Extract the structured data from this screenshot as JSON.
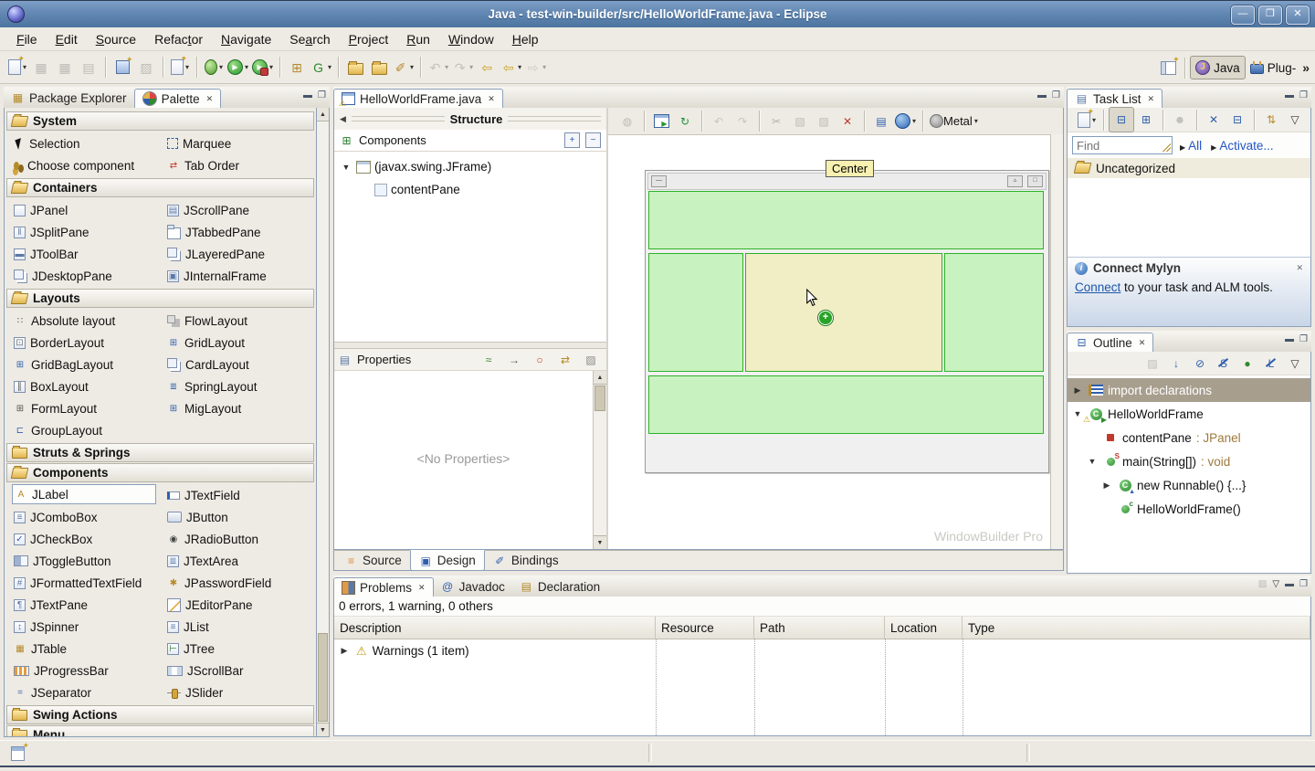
{
  "window": {
    "title": "Java - test-win-builder/src/HelloWorldFrame.java - Eclipse",
    "buttons": [
      {
        "name": "minimize-icon",
        "glyph": "—"
      },
      {
        "name": "maximize-icon",
        "glyph": "❐"
      },
      {
        "name": "close-icon",
        "glyph": "✕"
      }
    ]
  },
  "menu": {
    "items": [
      {
        "label": "File",
        "u": 0
      },
      {
        "label": "Edit",
        "u": 0
      },
      {
        "label": "Source",
        "u": 0
      },
      {
        "label": "Refactor",
        "u": 5
      },
      {
        "label": "Navigate",
        "u": 0
      },
      {
        "label": "Search",
        "u": 2
      },
      {
        "label": "Project",
        "u": 0
      },
      {
        "label": "Run",
        "u": 0
      },
      {
        "label": "Window",
        "u": 0
      },
      {
        "label": "Help",
        "u": 0
      }
    ]
  },
  "main_toolbar": {
    "groups": [
      [
        {
          "name": "new-wizard-icon",
          "k": "doc",
          "dd": true
        },
        {
          "name": "save-icon",
          "g": "▦",
          "c": "#777",
          "disabled": true
        },
        {
          "name": "save-all-icon",
          "g": "▦",
          "c": "#777",
          "disabled": true
        },
        {
          "name": "print-icon",
          "g": "▤",
          "c": "#777",
          "disabled": true
        }
      ],
      [
        {
          "name": "new-java-project-icon",
          "k": "doc2"
        },
        {
          "name": "type-hierarchy-icon",
          "g": "▨",
          "c": "#777",
          "disabled": true
        }
      ],
      [
        {
          "name": "open-wizard-icon",
          "k": "doc",
          "dd": true
        }
      ],
      [
        {
          "name": "debug-icon",
          "k": "bug",
          "dd": true
        },
        {
          "name": "run-icon",
          "k": "run",
          "dd": true
        },
        {
          "name": "run-last-icon",
          "k": "run2",
          "dd": true
        }
      ],
      [
        {
          "name": "new-java-class-icon",
          "g": "⊞",
          "c": "#b58a2a"
        },
        {
          "name": "gwt-compile-icon",
          "g": "G",
          "c": "#2e8b2e",
          "dd": true
        }
      ],
      [
        {
          "name": "open-type-icon",
          "k": "folder"
        },
        {
          "name": "open-resource-icon",
          "k": "folder"
        },
        {
          "name": "search-icon",
          "g": "✐",
          "c": "#b58a2a",
          "dd": true
        }
      ],
      [
        {
          "name": "last-edit-icon",
          "g": "↶",
          "c": "#888",
          "disabled": true,
          "dd": true
        },
        {
          "name": "next-annotation-icon",
          "g": "↷",
          "c": "#888",
          "disabled": true,
          "dd": true
        },
        {
          "name": "back-to-last-edit-icon",
          "g": "⇦",
          "c": "#c9a227"
        },
        {
          "name": "back-icon",
          "g": "⇦",
          "c": "#c9a227",
          "dd": true
        },
        {
          "name": "forward-icon",
          "g": "⇨",
          "c": "#c9a227",
          "disabled": true,
          "dd": true
        }
      ]
    ]
  },
  "perspective": {
    "open_icon": "open-perspective-icon",
    "buttons": [
      {
        "label": "Java",
        "icon": "java-perspective-icon",
        "active": true
      },
      {
        "label": "Plug-",
        "icon": "plugin-perspective-icon",
        "active": false
      }
    ],
    "more": "»"
  },
  "left_panel": {
    "tabs": [
      {
        "label": "Package Explorer",
        "icon": "package-explorer-icon",
        "active": false,
        "closable": false
      },
      {
        "label": "Palette",
        "icon": "palette-icon",
        "active": true,
        "closable": true
      }
    ],
    "palette": {
      "sections": [
        {
          "label": "System",
          "state": "open",
          "items": [
            {
              "label": "Selection",
              "icon": "selection-cursor-icon",
              "k": "cursor"
            },
            {
              "label": "Marquee",
              "icon": "marquee-icon",
              "k": "marquee"
            },
            {
              "label": "Choose component",
              "icon": "choose-component-icon",
              "k": "beans"
            },
            {
              "label": "Tab Order",
              "icon": "tab-order-icon",
              "g": "⇄",
              "c": "#c0392b"
            }
          ]
        },
        {
          "label": "Containers",
          "state": "open",
          "items": [
            {
              "label": "JPanel",
              "icon": "jpanel-icon",
              "box": true
            },
            {
              "label": "JScrollPane",
              "icon": "jscrollpane-icon",
              "box": true,
              "g": "▤",
              "c": "#5b79a6"
            },
            {
              "label": "JSplitPane",
              "icon": "jsplitpane-icon",
              "box": true,
              "g": "‖",
              "c": "#5b79a6"
            },
            {
              "label": "JTabbedPane",
              "icon": "jtabbedpane-icon",
              "k": "tabbed"
            },
            {
              "label": "JToolBar",
              "icon": "jtoolbar-icon",
              "box": true,
              "g": "▬",
              "c": "#5b79a6"
            },
            {
              "label": "JLayeredPane",
              "icon": "jlayeredpane-icon",
              "k": "layered"
            },
            {
              "label": "JDesktopPane",
              "icon": "jdesktoppane-icon",
              "k": "layered"
            },
            {
              "label": "JInternalFrame",
              "icon": "jinternalframe-icon",
              "box": true,
              "g": "▣",
              "c": "#5b79a6"
            }
          ]
        },
        {
          "label": "Layouts",
          "state": "open",
          "items": [
            {
              "label": "Absolute layout",
              "icon": "absolute-layout-icon",
              "g": "∷",
              "c": "#555"
            },
            {
              "label": "FlowLayout",
              "icon": "flowlayout-icon",
              "k": "flow"
            },
            {
              "label": "BorderLayout",
              "icon": "borderlayout-icon",
              "box": true,
              "g": "⊡",
              "c": "#777"
            },
            {
              "label": "GridLayout",
              "icon": "gridlayout-icon",
              "g": "⊞",
              "c": "#2f5fae"
            },
            {
              "label": "GridBagLayout",
              "icon": "gridbaglayout-icon",
              "g": "⊞",
              "c": "#2f5fae"
            },
            {
              "label": "CardLayout",
              "icon": "cardlayout-icon",
              "k": "layered"
            },
            {
              "label": "BoxLayout",
              "icon": "boxlayout-icon",
              "box": true,
              "g": "∥",
              "c": "#555"
            },
            {
              "label": "SpringLayout",
              "icon": "springlayout-icon",
              "g": "≣",
              "c": "#2f5fae"
            },
            {
              "label": "FormLayout",
              "icon": "formlayout-icon",
              "g": "⊞",
              "c": "#555"
            },
            {
              "label": "MigLayout",
              "icon": "miglayout-icon",
              "g": "⊞",
              "c": "#2f5fae"
            },
            {
              "label": "GroupLayout",
              "icon": "grouplayout-icon",
              "g": "⊏",
              "c": "#2f5fae"
            }
          ]
        },
        {
          "label": "Struts & Springs",
          "state": "closed",
          "items": []
        },
        {
          "label": "Components",
          "state": "open",
          "items": [
            {
              "label": "JLabel",
              "icon": "jlabel-icon",
              "g": "A",
              "c": "#b58a2a",
              "selected": true
            },
            {
              "label": "JTextField",
              "icon": "jtextfield-icon",
              "k": "tfield"
            },
            {
              "label": "JComboBox",
              "icon": "jcombobox-icon",
              "box": true,
              "g": "≡",
              "c": "#5b79a6"
            },
            {
              "label": "JButton",
              "icon": "jbutton-icon",
              "k": "btn"
            },
            {
              "label": "JCheckBox",
              "icon": "jcheckbox-icon",
              "box": true,
              "g": "✓",
              "c": "#2f5fae"
            },
            {
              "label": "JRadioButton",
              "icon": "jradiobutton-icon",
              "g": "◉",
              "c": "#444"
            },
            {
              "label": "JToggleButton",
              "icon": "jtogglebutton-icon",
              "k": "toggle"
            },
            {
              "label": "JTextArea",
              "icon": "jtextarea-icon",
              "box": true,
              "g": "≣",
              "c": "#5b79a6"
            },
            {
              "label": "JFormattedTextField",
              "icon": "jformattedtextfield-icon",
              "box": true,
              "g": "#",
              "c": "#5b79a6"
            },
            {
              "label": "JPasswordField",
              "icon": "jpasswordfield-icon",
              "g": "✱",
              "c": "#b58a2a"
            },
            {
              "label": "JTextPane",
              "icon": "jtextpane-icon",
              "box": true,
              "g": "¶",
              "c": "#5b79a6"
            },
            {
              "label": "JEditorPane",
              "icon": "jeditorpane-icon",
              "k": "editor"
            },
            {
              "label": "JSpinner",
              "icon": "jspinner-icon",
              "box": true,
              "g": "↕",
              "c": "#5b79a6"
            },
            {
              "label": "JList",
              "icon": "jlist-icon",
              "box": true,
              "g": "≡",
              "c": "#5b79a6"
            },
            {
              "label": "JTable",
              "icon": "jtable-icon",
              "g": "▦",
              "c": "#b58a2a"
            },
            {
              "label": "JTree",
              "icon": "jtree-icon",
              "box": true,
              "g": "⊢",
              "c": "#2e7d32"
            },
            {
              "label": "JProgressBar",
              "icon": "jprogressbar-icon",
              "k": "progress"
            },
            {
              "label": "JScrollBar",
              "icon": "jscrollbar-icon",
              "k": "scrollbar"
            },
            {
              "label": "JSeparator",
              "icon": "jseparator-icon",
              "g": "=",
              "c": "#2f5fae"
            },
            {
              "label": "JSlider",
              "icon": "jslider-icon",
              "k": "slider"
            }
          ]
        },
        {
          "label": "Swing Actions",
          "state": "closed",
          "items": []
        },
        {
          "label": "Menu",
          "state": "closed",
          "items": []
        }
      ]
    }
  },
  "editor": {
    "tab": {
      "label": "HelloWorldFrame.java",
      "icon": "java-file-warning-icon",
      "active": true,
      "closable": true
    },
    "structure": {
      "collapse_icon": "collapse-left-icon",
      "title": "Structure",
      "components_label": "Components",
      "expand_all_glyph": "+",
      "collapse_all_glyph": "−",
      "tree": [
        {
          "label": "(javax.swing.JFrame)",
          "icon": "jframe-icon",
          "arrow": "down",
          "depth": 0
        },
        {
          "label": "contentPane",
          "icon": "jpanel-icon",
          "arrow": "none",
          "depth": 1
        }
      ]
    },
    "properties": {
      "title": "Properties",
      "empty": "<No Properties>",
      "toolbar": [
        {
          "name": "show-events-icon",
          "g": "≈",
          "c": "#2e8b2e"
        },
        {
          "name": "goto-definition-icon",
          "g": "→",
          "c": "#555"
        },
        {
          "name": "show-advanced-icon",
          "g": "○",
          "c": "#c0392b"
        },
        {
          "name": "convert-icon",
          "g": "⇄",
          "c": "#b58a2a"
        },
        {
          "name": "categorize-icon",
          "g": "▨",
          "c": "#888"
        }
      ]
    },
    "design": {
      "toolbar_groups": [
        [
          {
            "name": "parse-icon",
            "g": "◍",
            "c": "#a66",
            "disabled": true
          }
        ],
        [
          {
            "name": "test-preview-icon",
            "k": "prevw"
          },
          {
            "name": "refresh-icon",
            "g": "↻",
            "c": "#1f8f3a"
          }
        ],
        [
          {
            "name": "undo-icon",
            "g": "↶",
            "c": "#b08d4a",
            "disabled": true
          },
          {
            "name": "redo-icon",
            "g": "↷",
            "c": "#b08d4a",
            "disabled": true
          }
        ],
        [
          {
            "name": "cut-icon",
            "g": "✂",
            "c": "#666",
            "disabled": true
          },
          {
            "name": "copy-icon",
            "g": "▧",
            "c": "#777",
            "disabled": true
          },
          {
            "name": "paste-icon",
            "g": "▨",
            "c": "#777",
            "disabled": true
          },
          {
            "name": "delete-icon",
            "g": "✕",
            "c": "#c0392b"
          }
        ],
        [
          {
            "name": "externalize-strings-icon",
            "g": "▤",
            "c": "#2f5fae"
          },
          {
            "name": "locale-globe-icon",
            "k": "globe",
            "dd": true
          }
        ]
      ],
      "lnf": {
        "icon": "look-and-feel-gear-icon",
        "label": "Metal"
      },
      "tooltip": "Center",
      "watermark": "WindowBuilder Pro",
      "regions": [
        {
          "name": "north-region",
          "fill": "green"
        },
        {
          "name": "west-region",
          "fill": "green"
        },
        {
          "name": "center-region",
          "fill": "center"
        },
        {
          "name": "east-region",
          "fill": "green"
        },
        {
          "name": "south-region",
          "fill": "green"
        }
      ],
      "colors": {
        "region_green": "#c9f2c1",
        "region_center": "#f1edc4",
        "region_border": "#2eb229"
      }
    },
    "bottom_tabs": [
      {
        "label": "Source",
        "icon": "source-tab-icon",
        "g": "≡",
        "c": "#e08a3c",
        "active": false
      },
      {
        "label": "Design",
        "icon": "design-tab-icon",
        "g": "▣",
        "c": "#2f5fae",
        "active": true
      },
      {
        "label": "Bindings",
        "icon": "bindings-tab-icon",
        "g": "✐",
        "c": "#2f5fae",
        "active": false
      }
    ]
  },
  "task_list": {
    "tab": {
      "label": "Task List",
      "icon": "task-list-icon",
      "active": true,
      "closable": true
    },
    "toolbar": [
      {
        "name": "new-task-icon",
        "k": "doc",
        "dd": true
      },
      {
        "name": "categorized-icon",
        "g": "⊟",
        "c": "#2f5fae",
        "pressed": true
      },
      {
        "name": "scheduled-icon",
        "g": "⊞",
        "c": "#2f5fae"
      },
      {
        "name": "focus-tasks-icon",
        "g": "☻",
        "c": "#777",
        "disabled": true
      },
      {
        "name": "filter-completed-icon",
        "g": "✕",
        "c": "#2f5fae"
      },
      {
        "name": "collapse-all-icon",
        "g": "⊟",
        "c": "#2f5fae"
      },
      {
        "name": "synchronize-icon",
        "g": "⇅",
        "c": "#b58a2a"
      },
      {
        "name": "view-menu-icon",
        "g": "▽",
        "c": "#333"
      }
    ],
    "find_placeholder": "Find",
    "links": [
      {
        "label": "All"
      },
      {
        "label": "Activate..."
      }
    ],
    "category": "Uncategorized",
    "mylyn": {
      "title": "Connect Mylyn",
      "link": "Connect",
      "rest": " to your task and ALM tools."
    }
  },
  "outline": {
    "tab": {
      "label": "Outline",
      "icon": "outline-icon",
      "active": true,
      "closable": true
    },
    "toolbar": [
      {
        "name": "focus-icon",
        "g": "▨",
        "c": "#777",
        "disabled": true
      },
      {
        "name": "sort-icon",
        "g": "↓",
        "c": "#2f5fae"
      },
      {
        "name": "hide-fields-icon",
        "g": "⊘",
        "c": "#2f5fae"
      },
      {
        "name": "hide-static-icon",
        "g": "S",
        "c": "#2f5fae",
        "slashed": true
      },
      {
        "name": "show-public-icon",
        "g": "●",
        "c": "#2e8b2e"
      },
      {
        "name": "hide-local-icon",
        "g": "L",
        "c": "#2f5fae",
        "slashed": true
      },
      {
        "name": "view-menu-icon",
        "g": "▽",
        "c": "#333"
      }
    ],
    "items": [
      {
        "label": "import declarations",
        "icon": "imports",
        "arrow": "right",
        "depth": 0,
        "selected": true
      },
      {
        "label": "HelloWorldFrame",
        "icon": "class-main",
        "arrow": "down",
        "depth": 0
      },
      {
        "label": "contentPane",
        "suffix": " : JPanel",
        "icon": "field-private",
        "arrow": "none",
        "depth": 1
      },
      {
        "label": "main(String[])",
        "suffix": " : void",
        "icon": "method-static",
        "arrow": "down",
        "depth": 1
      },
      {
        "label": "new Runnable() {...}",
        "icon": "class-anon",
        "arrow": "right",
        "depth": 2
      },
      {
        "label": "HelloWorldFrame()",
        "icon": "constructor",
        "arrow": "none",
        "depth": 2
      }
    ]
  },
  "problems": {
    "tabs": [
      {
        "label": "Problems",
        "icon": "problems-icon",
        "active": true,
        "closable": true
      },
      {
        "label": "Javadoc",
        "icon": "javadoc-icon",
        "g": "@",
        "c": "#2f5fae",
        "active": false
      },
      {
        "label": "Declaration",
        "icon": "declaration-icon",
        "g": "▤",
        "c": "#b58a2a",
        "active": false
      }
    ],
    "corner_icons": [
      {
        "name": "filter-icon",
        "g": "▨",
        "c": "#777",
        "disabled": true
      },
      {
        "name": "view-menu-icon",
        "g": "▽",
        "c": "#333"
      },
      {
        "name": "minimize-icon",
        "g": "▬",
        "c": "#44546a"
      },
      {
        "name": "maximize-icon",
        "g": "❐",
        "c": "#44546a"
      }
    ],
    "summary": "0 errors, 1 warning, 0 others",
    "columns": [
      "Description",
      "Resource",
      "Path",
      "Location",
      "Type"
    ],
    "rows": [
      {
        "arrow": "right",
        "icon": "warning-icon",
        "label": "Warnings (1 item)"
      }
    ]
  },
  "status_bar": {
    "icon": "fast-view-icon"
  }
}
